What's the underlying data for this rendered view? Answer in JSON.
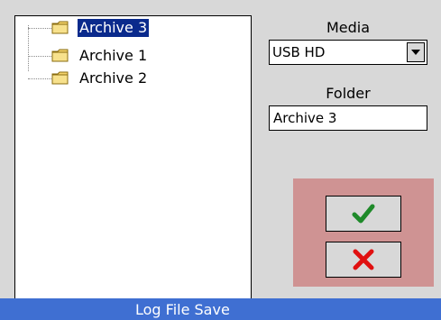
{
  "tree": {
    "items": [
      {
        "label": "Archive 3",
        "selected": true,
        "icon": "folder-icon"
      },
      {
        "label": "Archive 1",
        "selected": false,
        "icon": "folder-icon"
      },
      {
        "label": "Archive 2",
        "selected": false,
        "icon": "folder-icon"
      }
    ]
  },
  "media": {
    "label": "Media",
    "value": "USB HD",
    "icon": "chevron-down-icon"
  },
  "folder": {
    "label": "Folder",
    "value": "Archive 3"
  },
  "actions": {
    "confirm_icon": "checkmark-icon",
    "cancel_icon": "close-icon",
    "confirm_color": "#1f8a2a",
    "cancel_color": "#e01010",
    "panel_color": "#cf9393"
  },
  "status_bar": {
    "title": "Log File Save",
    "color": "#3f6fd2"
  }
}
